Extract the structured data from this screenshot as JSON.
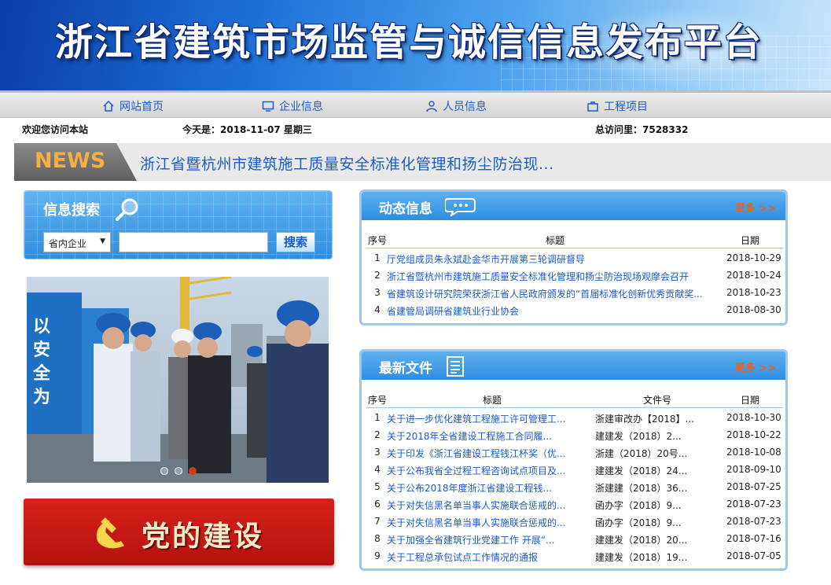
{
  "header": {
    "title": "浙江省建筑市场监管与诚信信息发布平台"
  },
  "nav": [
    {
      "label": "网站首页",
      "icon": "home-icon"
    },
    {
      "label": "企业信息",
      "icon": "monitor-icon"
    },
    {
      "label": "人员信息",
      "icon": "person-icon"
    },
    {
      "label": "工程项目",
      "icon": "briefcase-icon"
    }
  ],
  "infobar": {
    "welcome": "欢迎您访问本站",
    "today": "今天是：2018-11-07 星期三",
    "visits": "总访问里：7528332"
  },
  "news": {
    "label": "NEWS",
    "headline": "浙江省暨杭州市建筑施工质量安全标准化管理和扬尘防治现..."
  },
  "search": {
    "title": "信息搜索",
    "select_value": "省内企业",
    "button": "搜索"
  },
  "party": {
    "text": "党的建设"
  },
  "dynamic": {
    "title": "动态信息",
    "more": "更多 >>",
    "headers": {
      "no": "序号",
      "title": "标题",
      "date": "日期"
    },
    "rows": [
      {
        "no": "1",
        "title": "厅党组成员朱永斌赴金华市开展第三轮调研督导",
        "date": "2018-10-29"
      },
      {
        "no": "2",
        "title": "浙江省暨杭州市建筑施工质量安全标准化管理和扬尘防治现场观摩会召开",
        "date": "2018-10-24"
      },
      {
        "no": "3",
        "title": "省建筑设计研究院荣获浙江省人民政府颁发的“首届标准化创新优秀贡献奖...",
        "date": "2018-10-23"
      },
      {
        "no": "4",
        "title": "省建管局调研省建筑业行业协会",
        "date": "2018-08-30"
      }
    ]
  },
  "files": {
    "title": "最新文件",
    "more": "更多 >>",
    "headers": {
      "no": "序号",
      "title": "标题",
      "doc": "文件号",
      "date": "日期"
    },
    "rows": [
      {
        "no": "1",
        "title": "关于进一步优化建筑工程施工许可管理工...",
        "doc": "浙建审改办【2018】...",
        "date": "2018-10-30"
      },
      {
        "no": "2",
        "title": "关于2018年全省建设工程施工合同履...",
        "doc": "建建发（2018）2...",
        "date": "2018-10-22"
      },
      {
        "no": "3",
        "title": "关于印发《浙江省建设工程钱江杯奖（优...",
        "doc": "浙建（2018）20号...",
        "date": "2018-10-08"
      },
      {
        "no": "4",
        "title": "关于公布我省全过程工程咨询试点项目及...",
        "doc": "建建发（2018）24...",
        "date": "2018-09-10"
      },
      {
        "no": "5",
        "title": "关于公布2018年度浙江省建设工程钱...",
        "doc": "浙建建（2018）36...",
        "date": "2018-07-25"
      },
      {
        "no": "6",
        "title": "关于对失信黑名单当事人实施联合惩戒的...",
        "doc": "函办字（2018）9...",
        "date": "2018-07-23"
      },
      {
        "no": "7",
        "title": "关于对失信黑名单当事人实施联合惩戒的...",
        "doc": "函办字（2018）9...",
        "date": "2018-07-23"
      },
      {
        "no": "8",
        "title": "关于加强全省建筑行业党建工作 开展“...",
        "doc": "建建发（2018）20...",
        "date": "2018-07-16"
      },
      {
        "no": "9",
        "title": "关于工程总承包试点工作情况的通报",
        "doc": "建建发（2018）19...",
        "date": "2018-07-05"
      }
    ]
  },
  "photo_slider": {
    "slides": 3,
    "active_slide": 3
  }
}
